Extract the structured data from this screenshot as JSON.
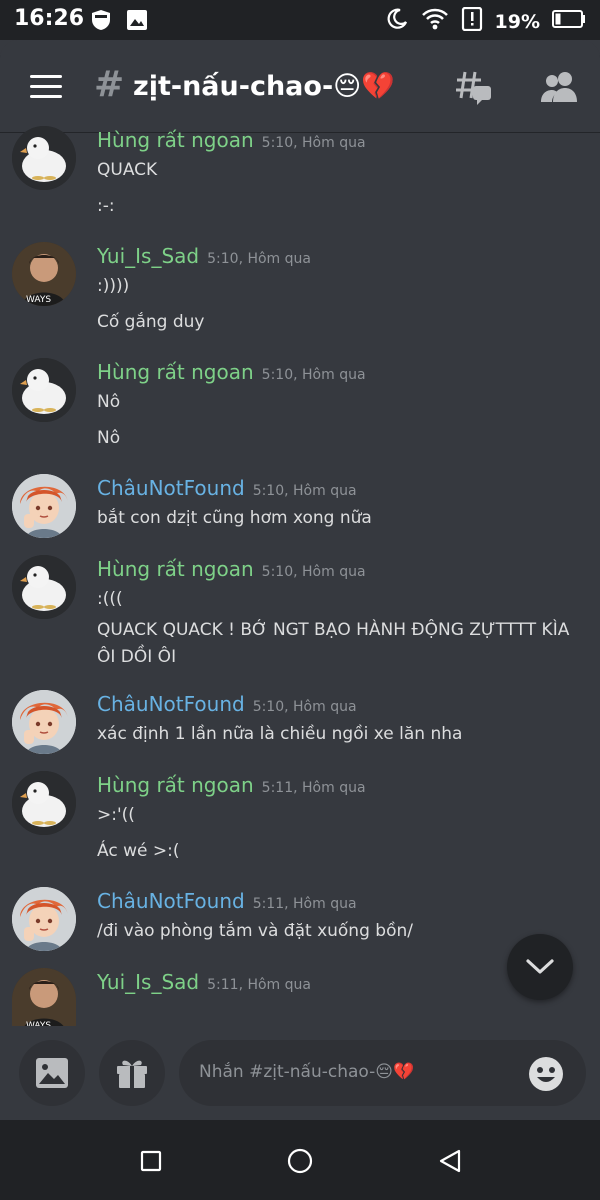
{
  "status_bar": {
    "time": "16:26",
    "battery": "19%",
    "icons": [
      "shield-icon",
      "image-icon",
      "moon-icon",
      "wifi-icon",
      "alert-icon",
      "battery-icon"
    ]
  },
  "header": {
    "channel_name": "zịt-nấu-chao-😔💔",
    "icons": [
      "menu-icon",
      "threads-icon",
      "members-icon"
    ]
  },
  "messages": [
    {
      "author": "Hùng rất ngoan",
      "time": "5:10, Hôm qua",
      "lines": [
        "QUACK",
        ":-:"
      ]
    },
    {
      "author": "Yui_Is_Sad",
      "time": "5:10, Hôm qua",
      "lines": [
        ":))))",
        "Cố gắng duy"
      ]
    },
    {
      "author": "Hùng rất ngoan",
      "time": "5:10, Hôm qua",
      "lines": [
        "Nô",
        "Nô"
      ]
    },
    {
      "author": "ChâuNotFound",
      "time": "5:10, Hôm qua",
      "lines": [
        "bắt con dzịt cũng hơm xong nữa"
      ]
    },
    {
      "author": "Hùng rất ngoan",
      "time": "5:10, Hôm qua",
      "lines": [
        ":(((",
        "QUACK QUACK ! BỚ NGT BẠO HÀNH ĐỘNG ZỰTTTT KÌA ÔI DỒI ÔI"
      ]
    },
    {
      "author": "ChâuNotFound",
      "time": "5:10, Hôm qua",
      "lines": [
        "xác định 1 lần nữa là chiều ngồi xe lăn nha"
      ]
    },
    {
      "author": "Hùng rất ngoan",
      "time": "5:11, Hôm qua",
      "lines": [
        ">:'((",
        "Ác wé >:("
      ]
    },
    {
      "author": "ChâuNotFound",
      "time": "5:11, Hôm qua",
      "lines": [
        "/đi vào phòng tắm và đặt xuống bồn/"
      ]
    },
    {
      "author": "Yui_Is_Sad",
      "time": "5:11, Hôm qua",
      "lines": []
    }
  ],
  "avatars": {
    "yui_shirt_text": "WAYS"
  },
  "composer": {
    "placeholder": "Nhắn #zịt-nấu-chao-😔💔",
    "icons": [
      "image-icon",
      "gift-icon",
      "emoji-icon"
    ]
  },
  "scroll_button": {
    "icon": "chevron-down-icon"
  },
  "nav_bar": {
    "icons": [
      "recents-icon",
      "home-icon",
      "back-icon"
    ]
  },
  "colors": {
    "background": "#36393f",
    "dark": "#202225",
    "input": "#2f3136",
    "name_green": "#7ed188",
    "name_blue": "#68b2e3"
  }
}
